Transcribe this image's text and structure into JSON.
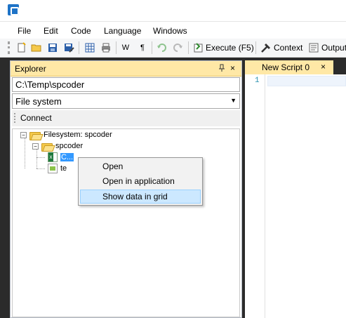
{
  "menubar": {
    "items": [
      "File",
      "Edit",
      "Code",
      "Language",
      "Windows"
    ]
  },
  "toolbar": {
    "w_label": "W",
    "para_label": "¶",
    "execute_label": "Execute (F5)",
    "context_label": "Context",
    "output_label": "Output"
  },
  "explorer": {
    "title": "Explorer",
    "pin_glyph": "ᵖ",
    "close_glyph": "×",
    "path_value": "C:\\Temp\\spcoder",
    "source_value": "File system",
    "connect_label": "Connect",
    "tree": {
      "root_label": "Filesystem: spcoder",
      "folder_label": "spcoder",
      "file1_label": "C...",
      "file2_label": "te"
    }
  },
  "context_menu": {
    "items": [
      "Open",
      "Open in application",
      "Show data in grid"
    ]
  },
  "editor": {
    "tab_label": "New Script 0",
    "tab_close_glyph": "×",
    "line_number": "1"
  },
  "colors": {
    "panel_header": "#ffe8a6",
    "dark_background": "#2b2b2b",
    "selection": "#3399ff",
    "menu_highlight": "#cce8ff"
  }
}
